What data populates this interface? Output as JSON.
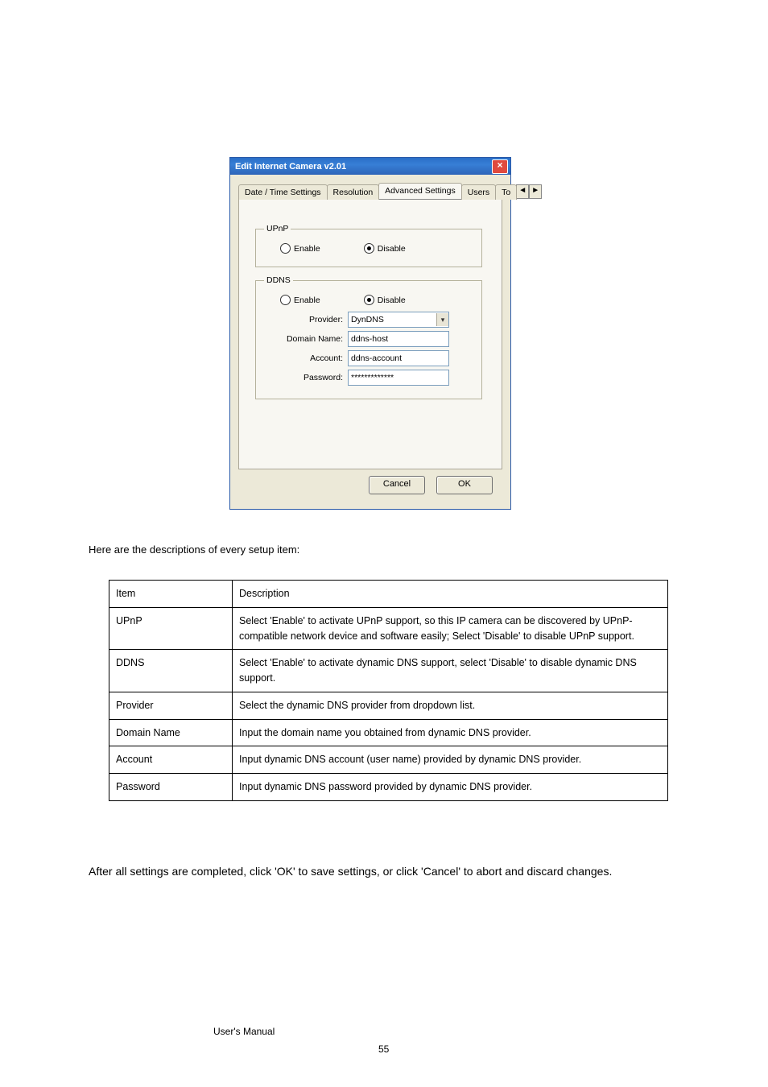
{
  "dialog": {
    "title": "Edit Internet Camera v2.01",
    "close": "×",
    "tabs": {
      "t1": "Date / Time Settings",
      "t2": "Resolution",
      "t3": "Advanced Settings",
      "t4": "Users",
      "t5": "To",
      "left_arrow": "◄",
      "right_arrow": "►"
    },
    "upnp": {
      "legend": "UPnP",
      "enable": "Enable",
      "disable": "Disable"
    },
    "ddns": {
      "legend": "DDNS",
      "enable": "Enable",
      "disable": "Disable",
      "provider_label": "Provider:",
      "provider_value": "DynDNS",
      "domain_label": "Domain Name:",
      "domain_value": "ddns-host",
      "account_label": "Account:",
      "account_value": "ddns-account",
      "password_label": "Password:",
      "password_value": "*************"
    },
    "buttons": {
      "cancel": "Cancel",
      "ok": "OK"
    }
  },
  "desc_heading": "Here are the descriptions of every setup item:",
  "table": {
    "h1": "Item",
    "h2": "Description",
    "r1k": "UPnP",
    "r1v": "Select 'Enable' to activate UPnP support, so this IP camera can be discovered by UPnP-compatible network device and software easily; Select 'Disable' to disable UPnP support.",
    "r2k": "DDNS",
    "r2v": "Select 'Enable' to activate dynamic DNS support, select 'Disable' to disable dynamic DNS support.",
    "r3k": "Provider",
    "r3v": "Select the dynamic DNS provider from dropdown list.",
    "r4k": "Domain Name",
    "r4v": "Input the domain name you obtained from dynamic DNS provider.",
    "r5k": "Account",
    "r5v": "Input dynamic DNS account (user name) provided by dynamic DNS provider.",
    "r6k": "Password",
    "r6v": "Input dynamic DNS password provided by dynamic DNS provider."
  },
  "bottom": "After all settings are completed, click 'OK' to save settings, or click 'Cancel' to abort and discard changes.",
  "footer": "User's Manual",
  "pagenum": "55"
}
